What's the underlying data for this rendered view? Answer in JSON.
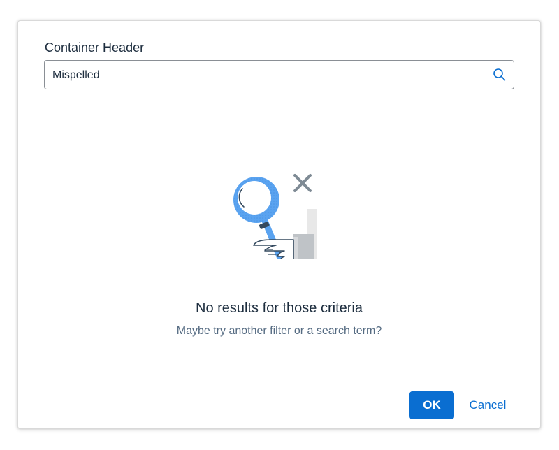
{
  "dialog": {
    "header_title": "Container Header",
    "search": {
      "value": "Mispelled",
      "icon": "search-icon"
    },
    "empty_state": {
      "illustration": "no-search-results-illustration",
      "title": "No results for those criteria",
      "subtitle": "Maybe try another filter or a search term?"
    },
    "footer": {
      "ok_label": "OK",
      "cancel_label": "Cancel"
    }
  },
  "colors": {
    "accent": "#0a6ed1",
    "text": "#1d2d3e",
    "muted_text": "#556b82",
    "border": "#d9d9d9",
    "illustration_blue": "#5aa3f0"
  }
}
